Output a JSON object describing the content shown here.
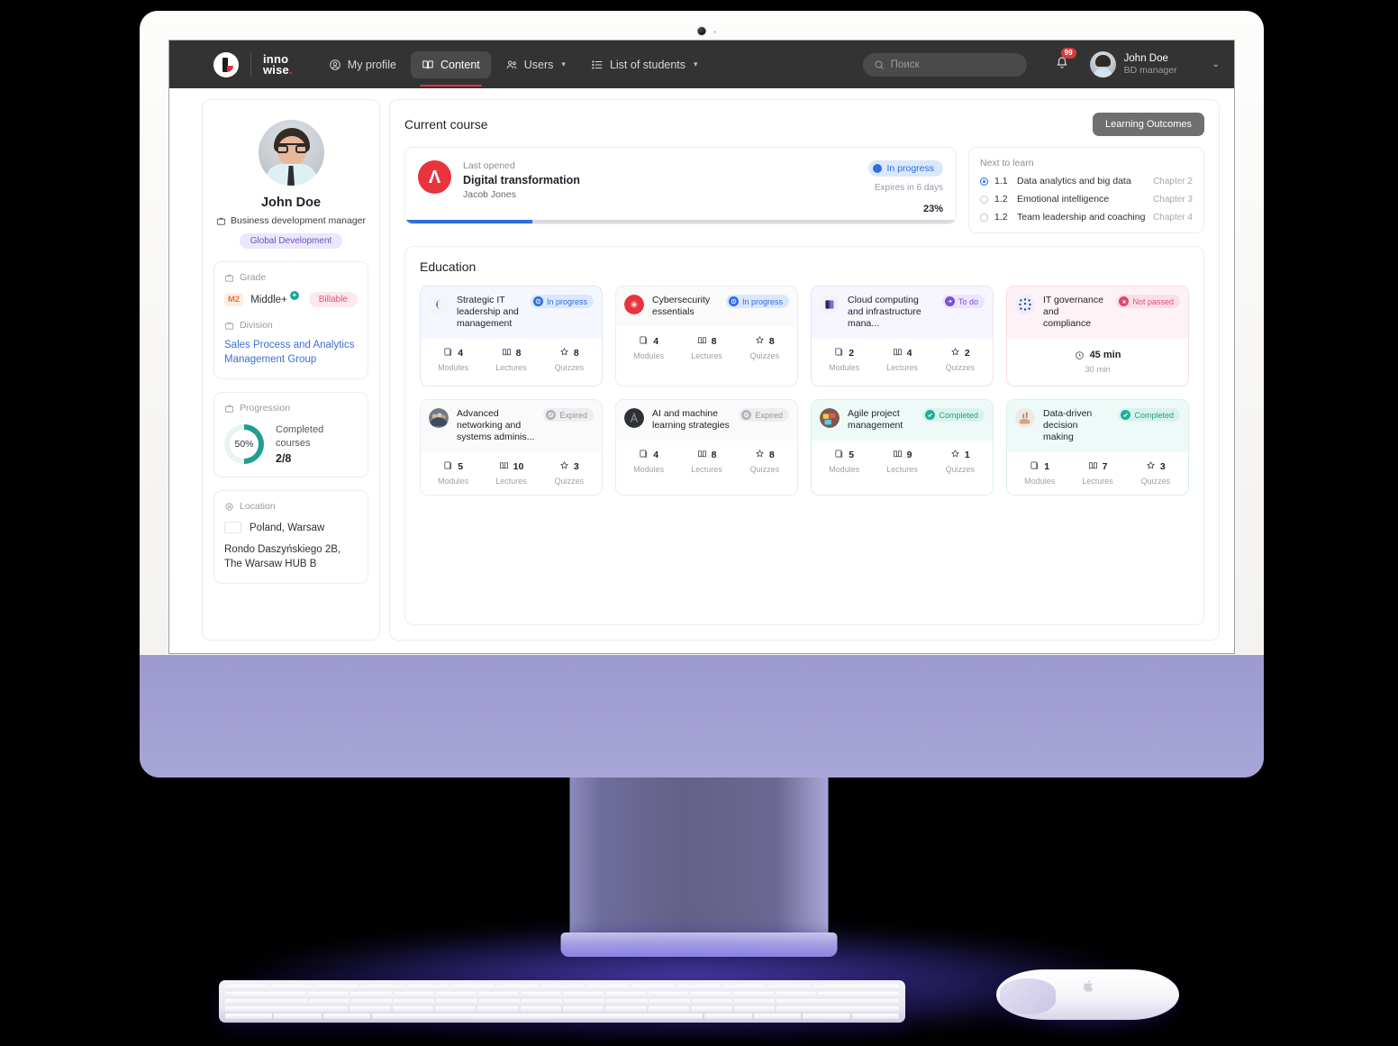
{
  "brand": {
    "name_line1": "inno",
    "name_line2": "wise",
    "dot": "."
  },
  "nav": {
    "items": [
      {
        "label": "My profile",
        "icon": "user-circle-icon",
        "active": false,
        "caret": false
      },
      {
        "label": "Content",
        "icon": "book-open-icon",
        "active": true,
        "caret": false
      },
      {
        "label": "Users",
        "icon": "users-icon",
        "active": false,
        "caret": true
      },
      {
        "label": "List of students",
        "icon": "list-icon",
        "active": false,
        "caret": true
      }
    ]
  },
  "search": {
    "placeholder": "Поиск",
    "icon": "search-icon"
  },
  "notifications": {
    "count": "99",
    "icon": "bell-icon"
  },
  "account": {
    "name": "John Doe",
    "role": "BD  manager",
    "caret": "⌄"
  },
  "profile": {
    "name": "John Doe",
    "title": "Business development manager",
    "title_icon": "briefcase-icon",
    "department_tag": "Global Development",
    "grade": {
      "label": "Grade",
      "label_icon": "briefcase-icon",
      "code": "M2",
      "level": "Middle+",
      "plus_badge": "+",
      "billable": "Billable"
    },
    "division": {
      "label": "Division",
      "label_icon": "briefcase-icon",
      "value": "Sales Process and Analytics Management Group"
    },
    "progression": {
      "label": "Progression",
      "label_icon": "briefcase-icon",
      "percent": "50%",
      "percent_value": 50,
      "caption": "Completed courses",
      "value": "2/8"
    },
    "location": {
      "label": "Location",
      "label_icon": "pin-icon",
      "country_city": "Poland, Warsaw",
      "flag": "poland-flag-icon",
      "address": "Rondo Daszyńskiego 2B, The Warsaw HUB B"
    }
  },
  "current_course": {
    "section_title": "Current course",
    "learning_outcomes_button": "Learning Outcomes",
    "last_opened_label": "Last opened",
    "course_name": "Digital transformation",
    "author": "Jacob Jones",
    "logo": "avatar-brand-icon",
    "status": "In progress",
    "expires": "Expires in 6 days",
    "percent_label": "23%",
    "percent_value": 23
  },
  "next_to_learn": {
    "title": "Next to learn",
    "items": [
      {
        "num": "1.1",
        "label": "Data analytics and big data",
        "chapter": "Chapter 2",
        "selected": true
      },
      {
        "num": "1.2",
        "label": "Emotional intelligence",
        "chapter": "Chapter 3",
        "selected": false
      },
      {
        "num": "1.2",
        "label": "Team leadership and coaching",
        "chapter": "Chapter 4",
        "selected": false
      }
    ]
  },
  "education": {
    "section_title": "Education",
    "stat_labels": {
      "modules": "Modules",
      "lectures": "Lectures",
      "quizzes": "Quizzes"
    },
    "courses": [
      {
        "title": "Strategic IT leadership and management",
        "status": "In progress",
        "status_kind": "st-progress",
        "status_icon": "clock-icon",
        "theme": "blue",
        "icon": "contentful-logo-icon",
        "modules": "4",
        "lectures": "8",
        "quizzes": "8"
      },
      {
        "title": "Cybersecurity essentials",
        "status": "In progress",
        "status_kind": "st-progress",
        "status_icon": "clock-icon",
        "theme": "grey",
        "icon": "red-shield-icon",
        "modules": "4",
        "lectures": "8",
        "quizzes": "8"
      },
      {
        "title": "Cloud computing and infrastructure mana...",
        "status": "To do",
        "status_kind": "st-todo",
        "status_icon": "arrow-right-icon",
        "theme": "purple",
        "icon": "cloud-cube-icon",
        "modules": "2",
        "lectures": "4",
        "quizzes": "2"
      },
      {
        "title": "IT governance and compliance",
        "status": "Not passed",
        "status_kind": "st-notpass",
        "status_icon": "close-icon",
        "theme": "red",
        "icon": "network-mesh-icon",
        "time_main": "45 min",
        "time_sub": "30 min",
        "time_icon": "clock-icon"
      },
      {
        "title": "Advanced networking and systems adminis...",
        "status": "Expired",
        "status_kind": "st-expired",
        "status_icon": "ban-icon",
        "theme": "grey",
        "icon": "team-photo-icon",
        "modules": "5",
        "lectures": "10",
        "quizzes": "3"
      },
      {
        "title": "AI and machine learning strategies",
        "status": "Expired",
        "status_kind": "st-expired",
        "status_icon": "ban-icon",
        "theme": "grey",
        "icon": "ai-dark-icon",
        "modules": "4",
        "lectures": "8",
        "quizzes": "8"
      },
      {
        "title": "Agile project management",
        "status": "Completed",
        "status_kind": "st-done",
        "status_icon": "check-icon",
        "theme": "green",
        "icon": "sticky-notes-icon",
        "modules": "5",
        "lectures": "9",
        "quizzes": "1"
      },
      {
        "title": "Data-driven decision making",
        "status": "Completed",
        "status_kind": "st-done",
        "status_icon": "check-icon",
        "theme": "green",
        "icon": "hand-chart-icon",
        "modules": "1",
        "lectures": "7",
        "quizzes": "3"
      }
    ]
  },
  "colors": {
    "accent_blue": "#2f6fe0",
    "brand_red": "#e8343c",
    "teal": "#1fae99",
    "purple_chin": "#a19ed3",
    "nav_bg": "#333333"
  }
}
